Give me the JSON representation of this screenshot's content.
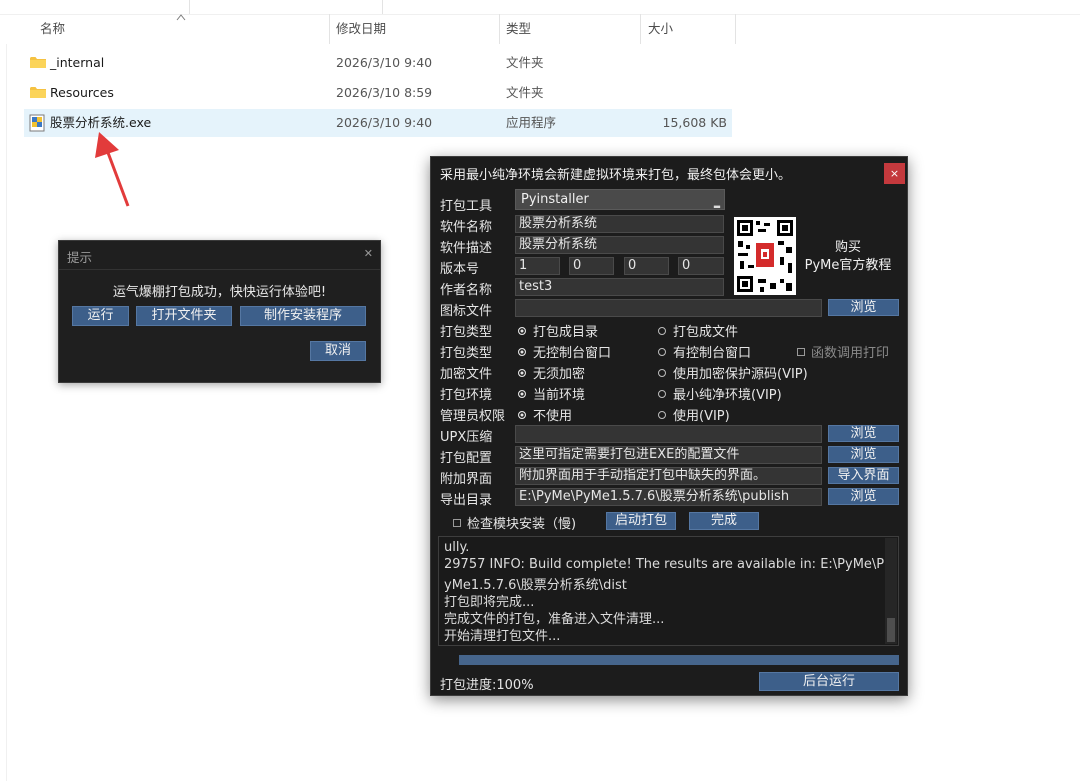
{
  "explorer": {
    "columns": {
      "name": "名称",
      "modified": "修改日期",
      "type": "类型",
      "size": "大小"
    },
    "files": [
      {
        "name": "_internal",
        "modified": "2026/3/10 9:40",
        "type": "文件夹",
        "size": "",
        "icon": "folder-icon"
      },
      {
        "name": "Resources",
        "modified": "2026/3/10 8:59",
        "type": "文件夹",
        "size": "",
        "icon": "folder-icon"
      },
      {
        "name": "股票分析系统.exe",
        "modified": "2026/3/10 9:40",
        "type": "应用程序",
        "size": "15,608 KB",
        "icon": "exe-icon"
      }
    ]
  },
  "hint_dialog": {
    "title": "提示",
    "message": "运气爆棚打包成功，快快运行体验吧!",
    "buttons": {
      "run": "运行",
      "open_folder": "打开文件夹",
      "make_installer": "制作安装程序",
      "cancel": "取消"
    }
  },
  "packer": {
    "title": "采用最小纯净环境会新建虚拟环境来打包，最终包体会更小。",
    "close": "×",
    "labels": {
      "tool": "打包工具",
      "name": "软件名称",
      "desc": "软件描述",
      "version": "版本号",
      "author": "作者名称",
      "icon": "图标文件",
      "type1": "打包类型",
      "type2": "打包类型",
      "encrypt": "加密文件",
      "env": "打包环境",
      "admin": "管理员权限",
      "upx": "UPX压缩",
      "config": "打包配置",
      "extra": "附加界面",
      "output": "导出目录"
    },
    "values": {
      "tool": "Pyinstaller",
      "name": "股票分析系统",
      "desc": "股票分析系统",
      "version": [
        "1",
        "0",
        "0",
        "0"
      ],
      "author": "test3",
      "icon": "",
      "upx": "",
      "config": "这里可指定需要打包进EXE的配置文件",
      "extra": "附加界面用于手动指定打包中缺失的界面。",
      "output": "E:\\PyMe\\PyMe1.5.7.6\\股票分析系统\\publish"
    },
    "buy": {
      "line1": "购买",
      "line2": "PyMe官方教程"
    },
    "options": {
      "dir": "打包成目录",
      "file": "打包成文件",
      "no_console": "无控制台窗口",
      "console": "有控制台窗口",
      "func_print": "函数调用打印",
      "no_encrypt": "无须加密",
      "encrypt": "使用加密保护源码(VIP)",
      "current_env": "当前环境",
      "min_env": "最小纯净环境(VIP)",
      "no_admin": "不使用",
      "admin": "使用(VIP)",
      "check_modules": "检查模块安装（慢)"
    },
    "buttons": {
      "browse": "浏览",
      "import_ui": "导入界面",
      "start": "启动打包",
      "done": "完成",
      "background": "后台运行"
    },
    "log": [
      "ully.",
      "29757 INFO: Build complete! The results are available in: E:\\PyMe\\P",
      "yMe1.5.7.6\\股票分析系统\\dist",
      "打包即将完成...",
      "完成文件的打包，准备进入文件清理...",
      "开始清理打包文件..."
    ],
    "progress_text": "打包进度:100%",
    "progress": 1.0
  },
  "colors": {
    "accent": "#3d5f8a",
    "close_red": "#c4393d",
    "selection": "#e5f3fb",
    "arrow": "#e23b3b"
  }
}
